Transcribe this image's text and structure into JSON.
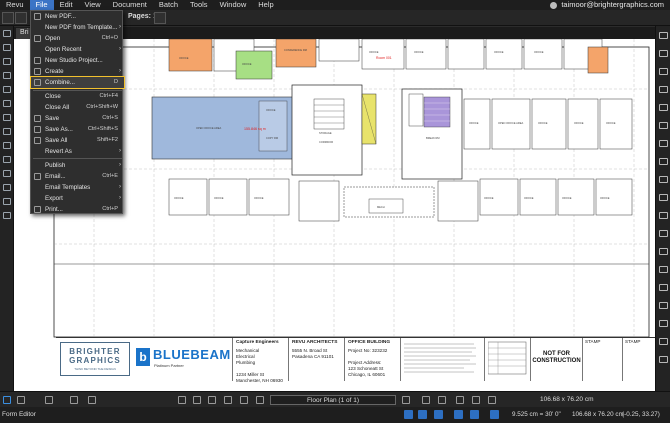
{
  "menubar": {
    "items": [
      "Revu",
      "File",
      "Edit",
      "View",
      "Document",
      "Batch",
      "Tools",
      "Window",
      "Help"
    ],
    "active": "File",
    "user": "taimoor@brightergraphics.com"
  },
  "toolbar": {
    "pages_label": "Pages:",
    "pages_value": "1"
  },
  "tab": {
    "label": "Bri"
  },
  "file_menu": {
    "items": [
      {
        "label": "New PDF...",
        "shortcut": "",
        "submenu": false
      },
      {
        "label": "New PDF from Template...",
        "shortcut": "",
        "submenu": true
      },
      {
        "label": "Open",
        "shortcut": "Ctrl+O",
        "submenu": false
      },
      {
        "label": "Open Recent",
        "shortcut": "",
        "submenu": true
      },
      {
        "label": "New Studio Project...",
        "shortcut": "",
        "submenu": false
      },
      {
        "label": "Create",
        "shortcut": "",
        "submenu": true
      },
      {
        "label": "Combine...",
        "shortcut": "D",
        "submenu": false
      },
      {
        "label": "Close",
        "shortcut": "Ctrl+F4",
        "submenu": false
      },
      {
        "label": "Close All",
        "shortcut": "Ctrl+Shift+W",
        "submenu": false
      },
      {
        "label": "Save",
        "shortcut": "Ctrl+S",
        "submenu": false
      },
      {
        "label": "Save As...",
        "shortcut": "Ctrl+Shift+S",
        "submenu": false
      },
      {
        "label": "Save All",
        "shortcut": "Shift+F2",
        "submenu": false
      },
      {
        "label": "Revert As",
        "shortcut": "",
        "submenu": true
      },
      {
        "label": "Publish",
        "shortcut": "",
        "submenu": true
      },
      {
        "label": "Email...",
        "shortcut": "Ctrl+E",
        "submenu": false
      },
      {
        "label": "Email Templates",
        "shortcut": "",
        "submenu": true
      },
      {
        "label": "Export",
        "shortcut": "",
        "submenu": true
      },
      {
        "label": "Print...",
        "shortcut": "Ctrl+P",
        "submenu": false
      }
    ],
    "highlighted": "Combine..."
  },
  "drawing": {
    "rooms": [
      "OPEN OFFICE AREA",
      "OFFICE",
      "CONFERENCE RM",
      "STORAGE",
      "CORRIDOR",
      "ELEV",
      "COPY RM",
      "STAIR",
      "BREAK RM",
      "TOILET",
      "MECH"
    ],
    "area_label": "Room 001",
    "area_value": "155.846 sq m"
  },
  "titleblock": {
    "brighter": {
      "line1": "BRIGHTER",
      "line2": "GRAPHICS",
      "line3": "THINK BEYOND THE DESIGN"
    },
    "bluebeam": {
      "mark": "b",
      "name": "BLUEBEAM",
      "sub": "Platinum Partner"
    },
    "capture": {
      "title": "Capture Engineers",
      "lines": [
        "Mechanical",
        "Electrical",
        "Plumbing",
        "",
        "1234 Miller St",
        "Manchester, NH 06930"
      ]
    },
    "revu": {
      "title": "REVU ARCHITECTS",
      "lines": [
        "5555 N. Broad St",
        "Pasadena CA 91101"
      ]
    },
    "office": {
      "title": "OFFICE BUILDING",
      "lines": [
        "Project No: 323232",
        "",
        "Project Address:",
        "123 Schoneatt St",
        "Chicago, IL 60601"
      ]
    },
    "not_for_construction": "NOT FOR CONSTRUCTION",
    "stamp1": "STAMP",
    "stamp2": "STAMP"
  },
  "bottombar": {
    "page_select": "Floor Plan (1 of 1)",
    "dimensions_left": "106.68 x 76.20 cm",
    "dimensions_right": "106.68 x 76.20 cm"
  },
  "statusbar": {
    "mode": "Form Editor",
    "scale1": "9.525 cm = 30' 0\"",
    "scale2": "9.525 cm = 30' 0\"",
    "coords": "(-0.25, 33.27)"
  },
  "colors": {
    "accent": "#3b74c6",
    "highlight": "#f2c12e",
    "brand_blue": "#1a73c9",
    "room_blue": "#9fb8dc",
    "room_orange": "#f4a46a",
    "room_green": "#a7df84",
    "room_purple": "#a995d9",
    "room_yellow": "#e8e36b"
  }
}
